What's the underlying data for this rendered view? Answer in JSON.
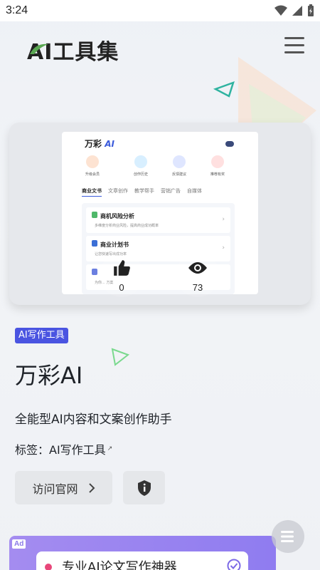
{
  "status_bar": {
    "time": "3:24"
  },
  "header": {
    "logo_text": "AI工具集"
  },
  "preview": {
    "brand_name": "万彩",
    "brand_mark": "AI",
    "quick_actions": [
      "升级会员",
      "创作历史",
      "反馈建议",
      "推荐有奖"
    ],
    "tabs": [
      "商业文书",
      "文章创作",
      "教学帮手",
      "营销广告",
      "自媒体"
    ],
    "rows": [
      {
        "title": "商机风险分析",
        "desc": "多维度分析商业风险，提高商业成功概率"
      },
      {
        "title": "商业计划书",
        "desc": "让您快速写出成功率"
      },
      {
        "title": "",
        "desc": "为你... 方案"
      }
    ],
    "likes": "0",
    "views": "73"
  },
  "tool": {
    "category_tag": "AI写作工具",
    "name": "万彩AI",
    "description": "全能型AI内容和文案创作助手",
    "tags_label": "标签：",
    "tag_link": "AI写作工具",
    "visit_label": "访问官网"
  },
  "ad": {
    "label": "Ad",
    "text": "专业AI论文写作神器"
  },
  "colors": {
    "accent": "#4a54e1",
    "ad_bg": "#a48cf0"
  }
}
